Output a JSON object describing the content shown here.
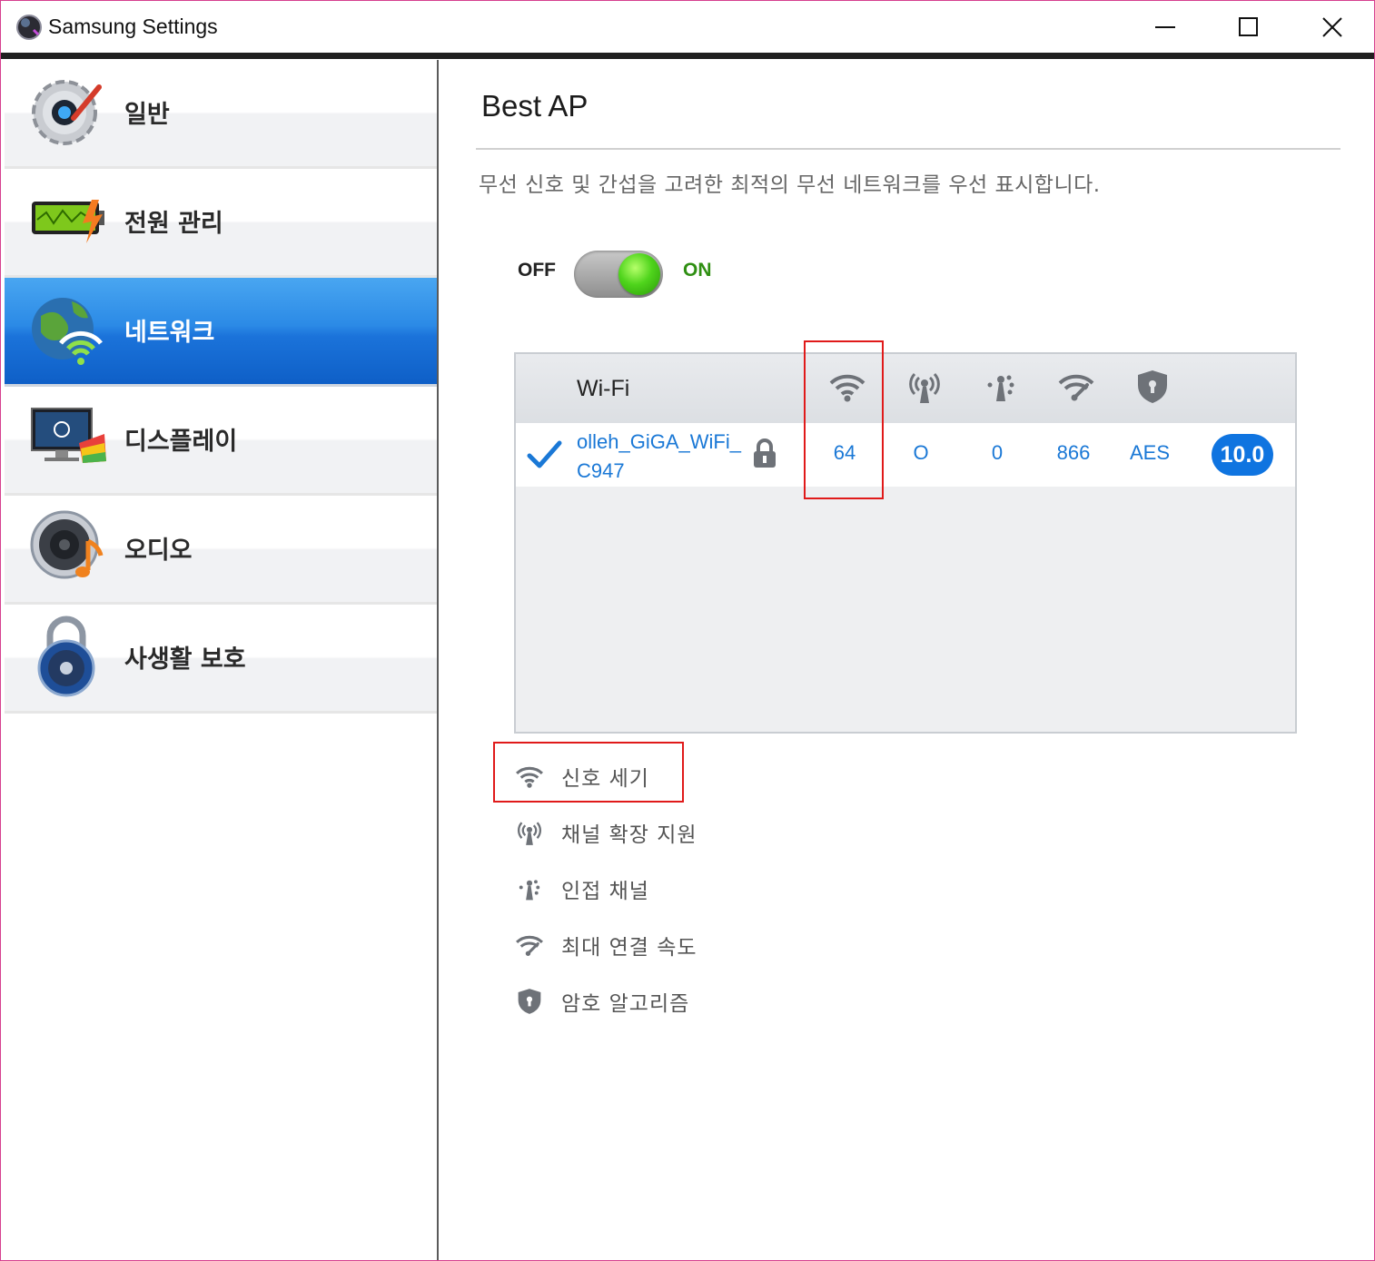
{
  "window": {
    "title": "Samsung Settings"
  },
  "sidebar": {
    "items": [
      {
        "label": "일반",
        "icon": "general-settings-icon",
        "active": false
      },
      {
        "label": "전원 관리",
        "icon": "battery-icon",
        "active": false
      },
      {
        "label": "네트워크",
        "icon": "network-globe-icon",
        "active": true
      },
      {
        "label": "디스플레이",
        "icon": "display-icon",
        "active": false
      },
      {
        "label": "오디오",
        "icon": "speaker-icon",
        "active": false
      },
      {
        "label": "사생활 보호",
        "icon": "padlock-icon",
        "active": false
      }
    ]
  },
  "main": {
    "title": "Best AP",
    "description": "무선 신호 및 간섭을 고려한 최적의 무선 네트워크를 우선 표시합니다.",
    "toggle": {
      "off_label": "OFF",
      "on_label": "ON",
      "state": "on"
    },
    "table": {
      "header": {
        "wifi_label": "Wi-Fi",
        "icons": [
          "signal-strength-icon",
          "channel-extension-icon",
          "adjacent-channel-icon",
          "max-speed-icon",
          "encryption-shield-icon"
        ]
      },
      "rows": [
        {
          "connected": true,
          "ssid": "olleh_GiGA_WiFi_C947",
          "secured": true,
          "signal": "64",
          "channel_extension": "O",
          "adjacent_channel": "0",
          "max_speed": "866",
          "encryption": "AES",
          "score": "10.0"
        }
      ]
    },
    "legend": [
      {
        "label": "신호 세기",
        "icon": "signal-strength-icon"
      },
      {
        "label": "채널 확장 지원",
        "icon": "channel-extension-icon"
      },
      {
        "label": "인접 채널",
        "icon": "adjacent-channel-icon"
      },
      {
        "label": "최대 연결 속도",
        "icon": "max-speed-icon"
      },
      {
        "label": "암호 알고리즘",
        "icon": "encryption-shield-icon"
      }
    ]
  },
  "colors": {
    "accent_blue": "#1a78d6",
    "active_nav": "#1b73da",
    "toggle_on_green": "#2f8f12",
    "highlight_red": "#e01a1a"
  }
}
